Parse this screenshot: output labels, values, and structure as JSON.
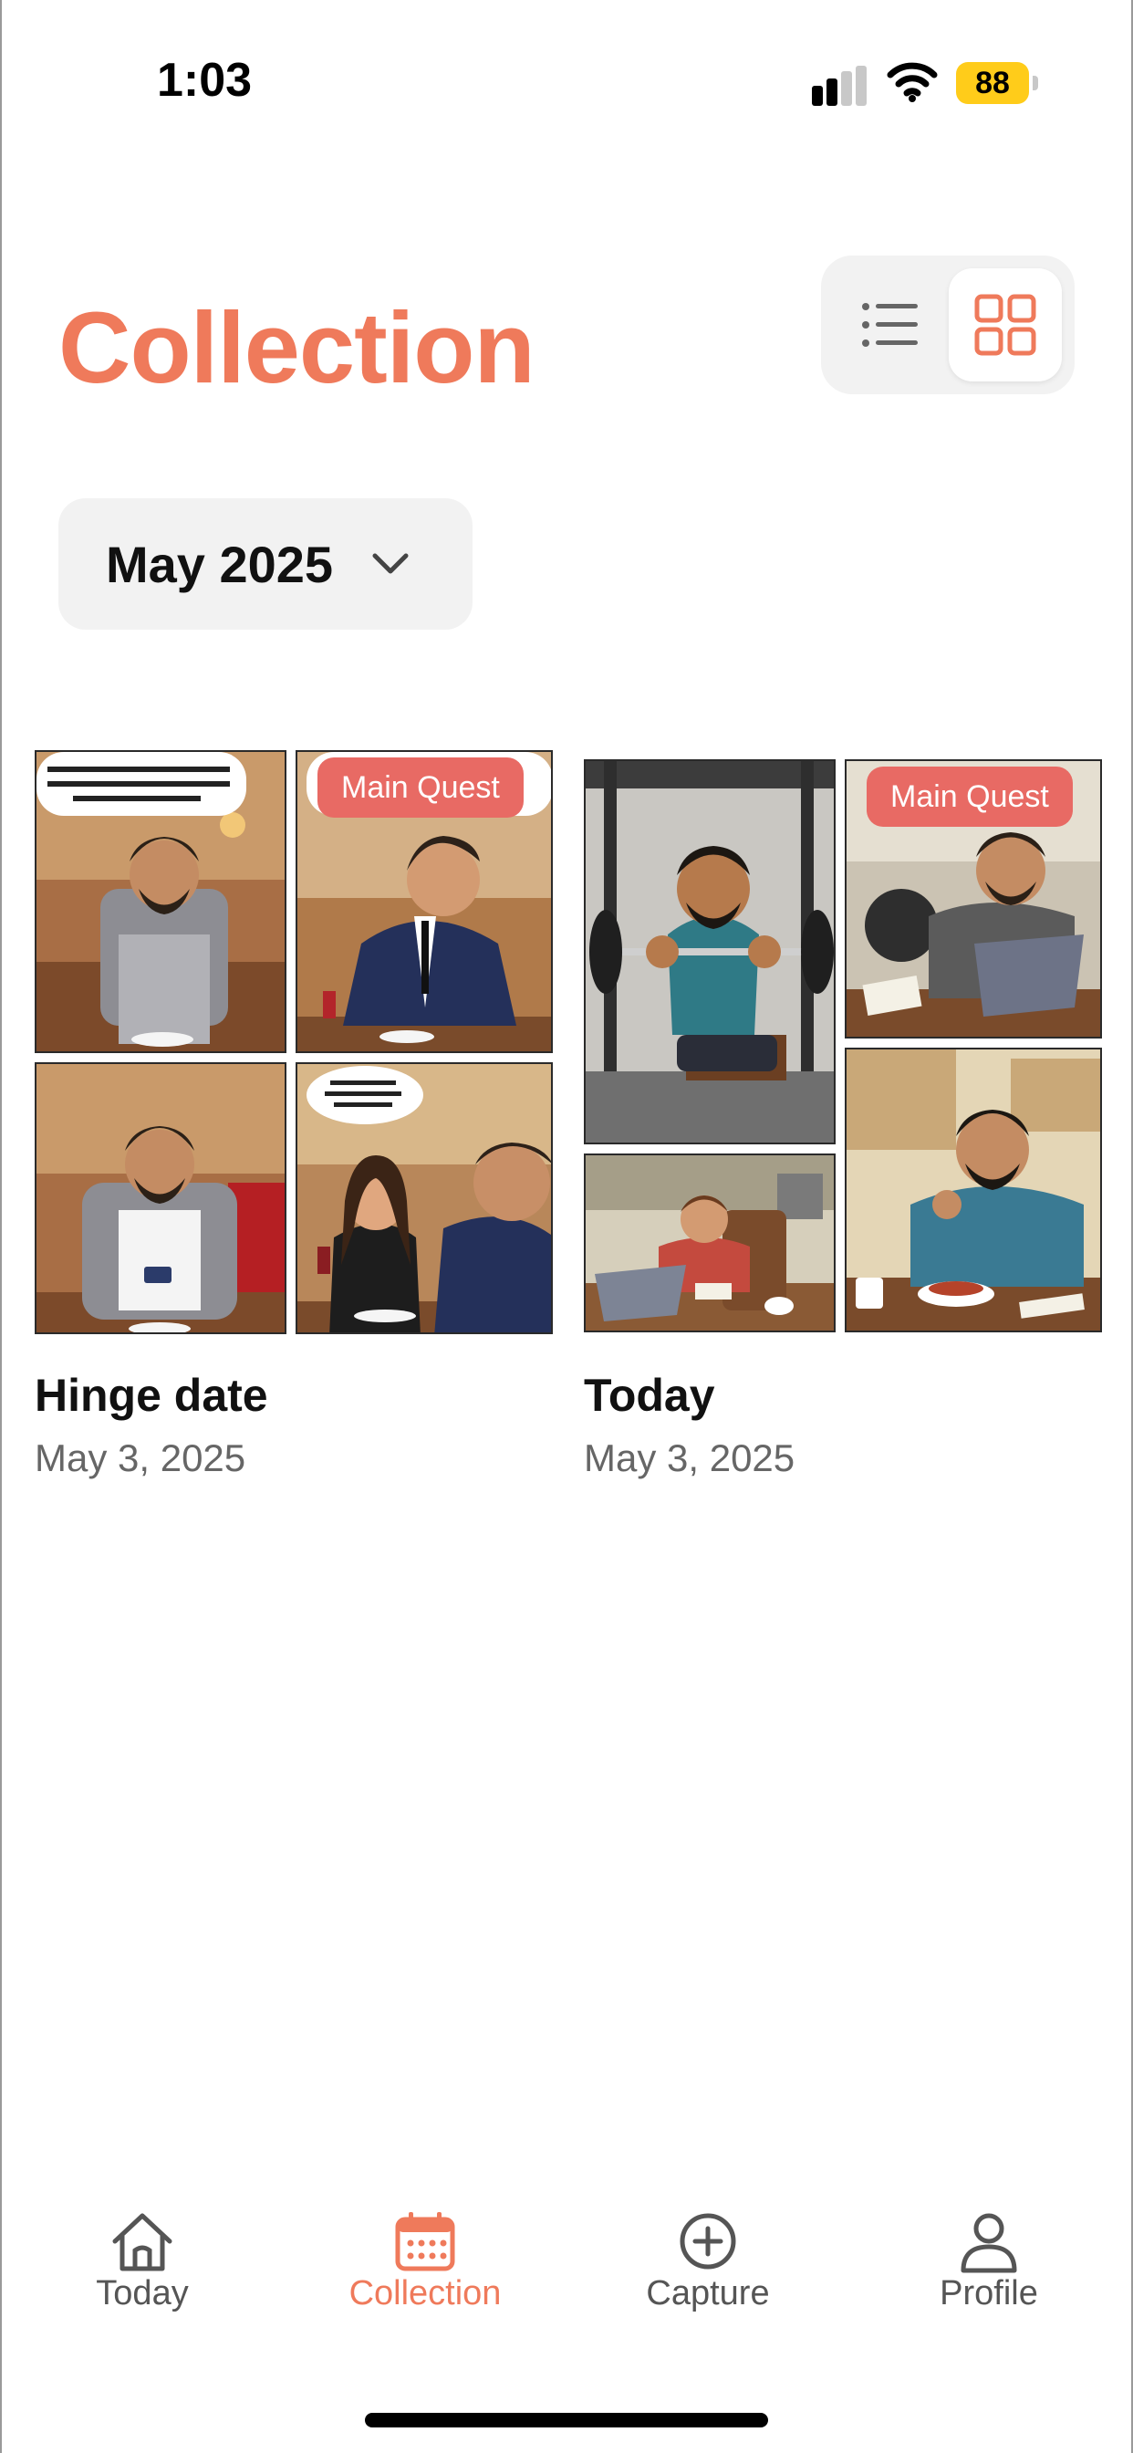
{
  "status_bar": {
    "time": "1:03",
    "battery": "88"
  },
  "header": {
    "title": "Collection"
  },
  "view_toggle": {
    "list_icon": "list-icon",
    "grid_icon": "grid-icon",
    "selected": "grid"
  },
  "filter": {
    "month": "May 2025"
  },
  "cards": [
    {
      "title": "Hinge date",
      "date": "May 3, 2025",
      "badge": "Main Quest"
    },
    {
      "title": "Today",
      "date": "May 3, 2025",
      "badge": "Main Quest"
    }
  ],
  "tab_bar": {
    "items": [
      {
        "label": "Today",
        "icon": "home-icon"
      },
      {
        "label": "Collection",
        "icon": "calendar-icon"
      },
      {
        "label": "Capture",
        "icon": "plus-circle-icon"
      },
      {
        "label": "Profile",
        "icon": "person-icon"
      }
    ],
    "active": "Collection"
  },
  "colors": {
    "accent": "#ef7a5b",
    "badge": "#e86a64",
    "battery": "#ffcc1a"
  }
}
